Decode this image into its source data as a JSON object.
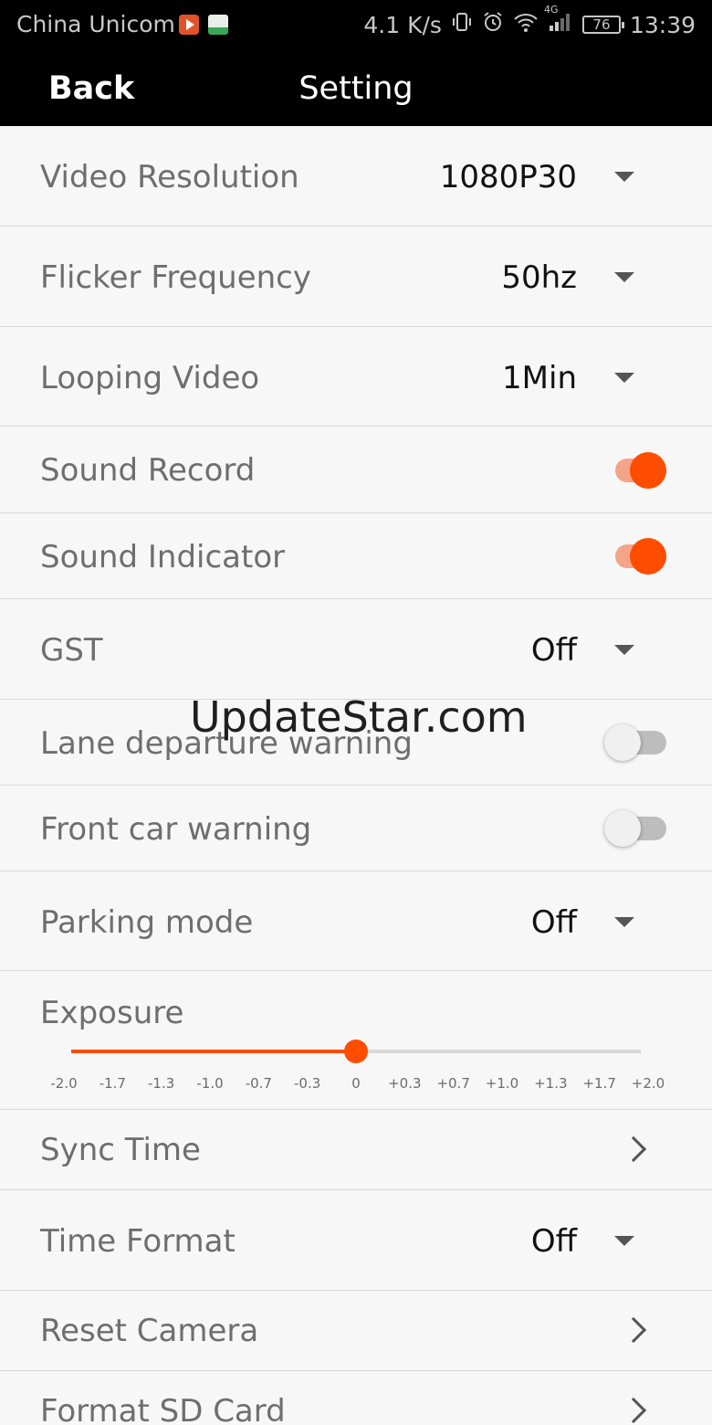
{
  "status_bar": {
    "carrier": "China Unicom",
    "speed": "4.1 K/s",
    "network": "4G",
    "battery": "76",
    "time": "13:39"
  },
  "header": {
    "back": "Back",
    "title": "Setting"
  },
  "settings": {
    "video_resolution": {
      "label": "Video Resolution",
      "value": "1080P30"
    },
    "flicker_frequency": {
      "label": "Flicker Frequency",
      "value": "50hz"
    },
    "looping_video": {
      "label": "Looping Video",
      "value": "1Min"
    },
    "sound_record": {
      "label": "Sound Record",
      "on": true
    },
    "sound_indicator": {
      "label": "Sound Indicator",
      "on": true
    },
    "gst": {
      "label": "GST",
      "value": "Off"
    },
    "lane_departure": {
      "label": "Lane departure warning",
      "on": false
    },
    "front_car": {
      "label": "Front car warning",
      "on": false
    },
    "parking_mode": {
      "label": "Parking mode",
      "value": "Off"
    },
    "exposure": {
      "label": "Exposure",
      "value": "0",
      "ticks": [
        "-2.0",
        "-1.7",
        "-1.3",
        "-1.0",
        "-0.7",
        "-0.3",
        "0",
        "+0.3",
        "+0.7",
        "+1.0",
        "+1.3",
        "+1.7",
        "+2.0"
      ]
    },
    "sync_time": {
      "label": "Sync Time"
    },
    "time_format": {
      "label": "Time Format",
      "value": "Off"
    },
    "reset_camera": {
      "label": "Reset Camera"
    },
    "format_sd": {
      "label": "Format SD Card"
    }
  },
  "watermark": "UpdateStar.com",
  "colors": {
    "accent": "#ff4d00",
    "accent_track": "#f4a488",
    "header_bg": "#000000"
  }
}
